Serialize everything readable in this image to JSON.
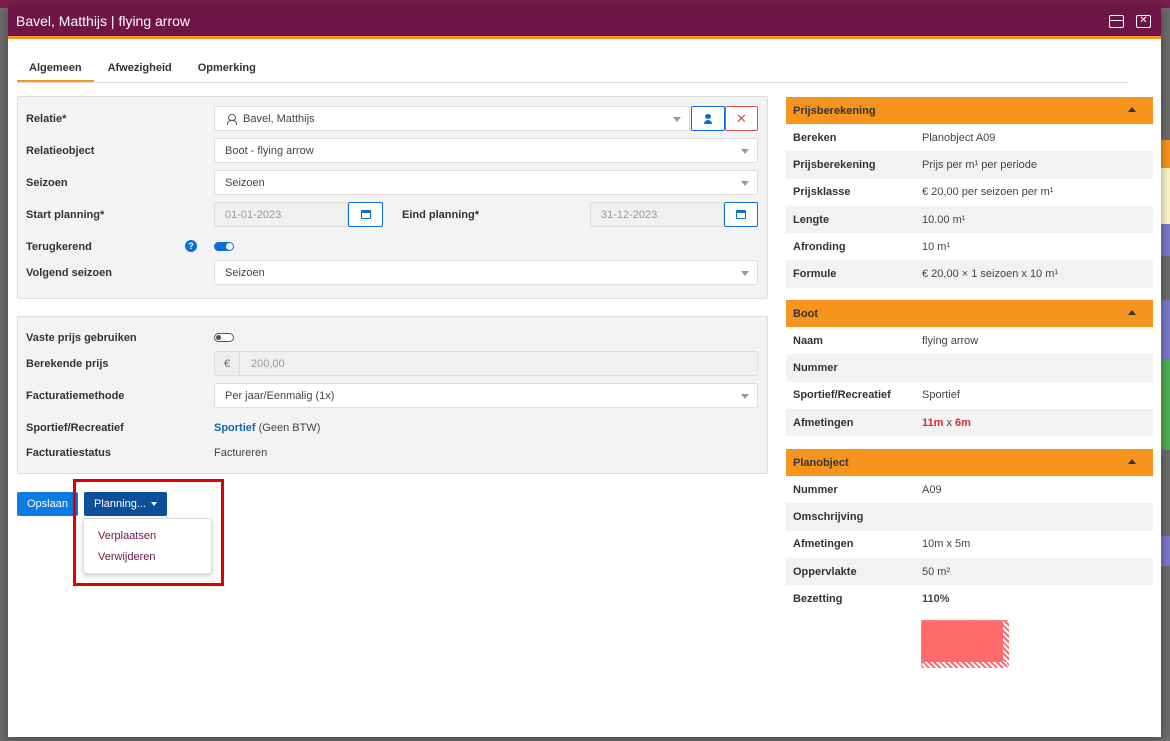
{
  "modal": {
    "title": "Bavel, Matthijs | flying arrow",
    "colors": {
      "header": "#6e1447",
      "accent": "#f7941d",
      "primary": "#0a7be0"
    }
  },
  "tabs": [
    {
      "label": "Algemeen",
      "active": true
    },
    {
      "label": "Afwezigheid"
    },
    {
      "label": "Opmerking"
    }
  ],
  "form": {
    "relatie_label": "Relatie*",
    "relatie_value": "Bavel, Matthijs",
    "relatieobject_label": "Relatieobject",
    "relatieobject_value": "Boot - flying arrow",
    "seizoen_label": "Seizoen",
    "seizoen_value": "Seizoen",
    "start_label": "Start planning*",
    "start_value": "01-01-2023",
    "eind_label": "Eind planning*",
    "eind_value": "31-12-2023",
    "terugkerend_label": "Terugkerend",
    "volgend_label": "Volgend seizoen",
    "volgend_value": "Seizoen",
    "vaste_label": "Vaste prijs gebruiken",
    "berekende_label": "Berekende prijs",
    "currency": "€",
    "berekende_value": "200,00",
    "factmethode_label": "Facturatiemethode",
    "factmethode_value": "Per jaar/Eenmalig (1x)",
    "sportief_label": "Sportief/Recreatief",
    "sportief_value": "Sportief",
    "sportief_suffix": "(Geen BTW)",
    "factstatus_label": "Facturatiestatus",
    "factstatus_value": "Factureren",
    "close_x": "✕",
    "help": "?"
  },
  "buttons": {
    "save": "Opslaan",
    "planning": "Planning...",
    "menu": [
      "Verplaatsen",
      "Verwijderen"
    ]
  },
  "prijs": {
    "title": "Prijsberekening",
    "rows": [
      {
        "k": "Bereken",
        "v": "Planobject A09"
      },
      {
        "k": "Prijsberekening",
        "v": "Prijs per m¹ per periode"
      },
      {
        "k": "Prijsklasse",
        "v": "€ 20,00 per seizoen per m¹"
      },
      {
        "k": "Lengte",
        "v": "10.00 m¹"
      },
      {
        "k": "Afronding",
        "v": "10 m¹"
      },
      {
        "k": "Formule",
        "v": "€ 20,00 × 1 seizoen x 10 m¹"
      }
    ]
  },
  "boot": {
    "title": "Boot",
    "rows": [
      {
        "k": "Naam",
        "v": "flying arrow"
      },
      {
        "k": "Nummer",
        "v": ""
      },
      {
        "k": "Sportief/Recreatief",
        "v": "Sportief"
      },
      {
        "k": "Afmetingen",
        "v_a": "11m",
        "v_x": "x",
        "v_b": "6m"
      }
    ]
  },
  "planobject": {
    "title": "Planobject",
    "rows": [
      {
        "k": "Nummer",
        "v": "A09"
      },
      {
        "k": "Omschrijving",
        "v": ""
      },
      {
        "k": "Afmetingen",
        "v": "10m x 5m"
      },
      {
        "k": "Oppervlakte",
        "v": "50 m²"
      },
      {
        "k": "Bezetting",
        "v": "110%"
      }
    ]
  }
}
